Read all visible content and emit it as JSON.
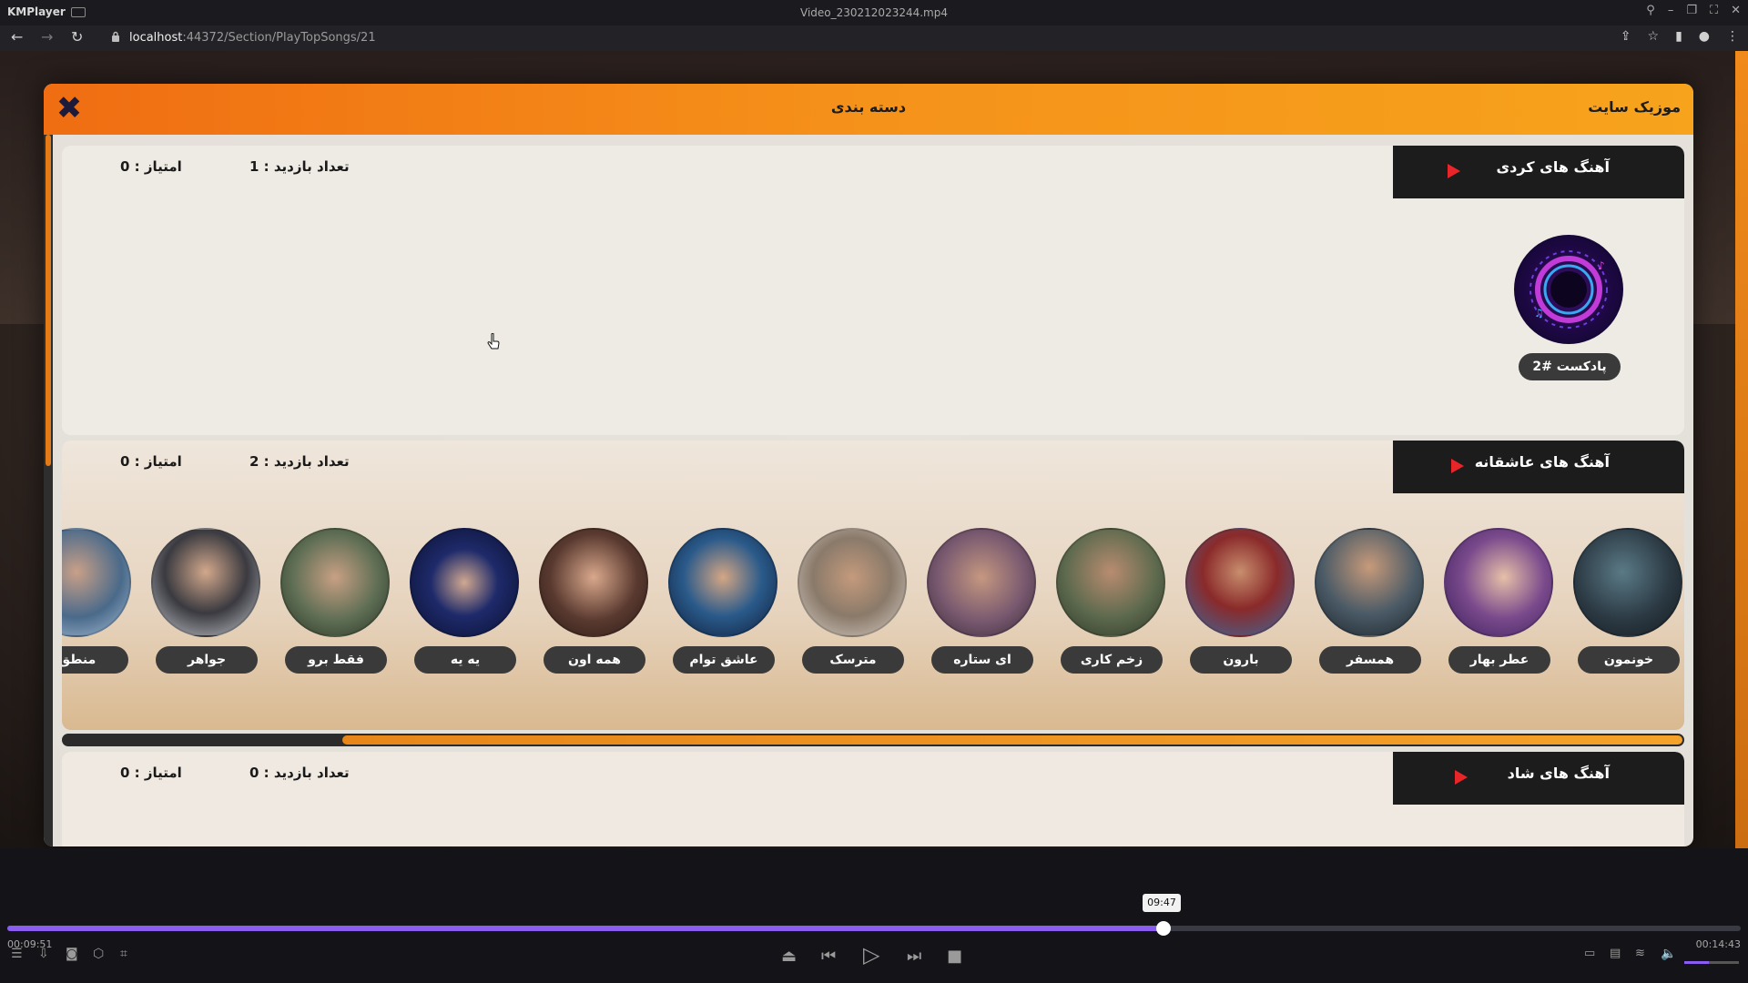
{
  "player": {
    "app_name": "KMPlayer",
    "file_name": "Video_230212023244.mp4",
    "tooltip_time": "09:47",
    "elapsed": "00:09:51",
    "total": "00:14:43",
    "progress_fraction": 0.667,
    "volume_fraction": 0.45
  },
  "browser": {
    "url_host": "localhost",
    "url_path": ":44372/Section/PlayTopSongs/21"
  },
  "modal": {
    "title": "دسته بندی",
    "site_title": "موزیک سایت",
    "close_glyph": "✖"
  },
  "sections": [
    {
      "title": "آهنگ های کردی",
      "visits_label": "تعداد بازدید : 1",
      "score_label": "امتیاز : 0",
      "podcast_label": "پادکست #2"
    },
    {
      "title": "آهنگ های عاشقانه",
      "visits_label": "تعداد بازدید : 2",
      "score_label": "امتیاز : 0",
      "songs": [
        "خونمون",
        "عطر بهار",
        "همسفر",
        "بارون",
        "زخم کاری",
        "ای ستاره",
        "مترسک",
        "عاشق توام",
        "همه اون",
        "یه یه",
        "فقط برو",
        "جواهر",
        "منطق"
      ]
    },
    {
      "title": "آهنگ های شاد",
      "visits_label": "تعداد بازدید : 0",
      "score_label": "امتیاز : 0"
    }
  ],
  "colors": {
    "header_orange": "#f5921a",
    "accent_purple": "#8a5cf0",
    "play_red": "#e8262a",
    "tab_dark": "#1c1c1c"
  }
}
